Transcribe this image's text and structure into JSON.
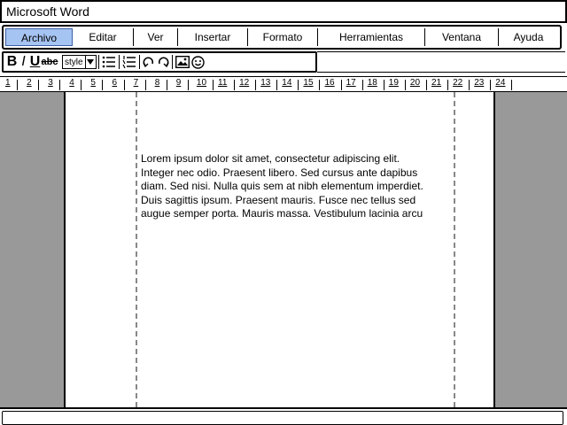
{
  "window": {
    "title": "Microsoft Word"
  },
  "menu": {
    "items": [
      {
        "label": "Archivo",
        "active": true
      },
      {
        "label": "Editar"
      },
      {
        "label": "Ver"
      },
      {
        "label": "Insertar"
      },
      {
        "label": "Formato"
      },
      {
        "label": "Herramientas"
      },
      {
        "label": "Ventana"
      },
      {
        "label": "Ayuda"
      }
    ],
    "active_color": "#a6c4f2"
  },
  "toolbar": {
    "bold": "B",
    "italic": "I",
    "underline": "U",
    "strike": "abc",
    "style_label": "style",
    "icons": [
      "bold-icon",
      "italic-icon",
      "underline-icon",
      "strikethrough-icon",
      "style-dropdown",
      "bulleted-list-icon",
      "numbered-list-icon",
      "undo-icon",
      "redo-icon",
      "image-icon",
      "emoji-icon"
    ]
  },
  "ruler": {
    "ticks": [
      "1",
      "2",
      "3",
      "4",
      "5",
      "6",
      "7",
      "8",
      "9",
      "10",
      "11",
      "12",
      "13",
      "14",
      "15",
      "16",
      "17",
      "18",
      "19",
      "20",
      "21",
      "22",
      "23",
      "24"
    ]
  },
  "document": {
    "lines": [
      "Lorem ipsum dolor sit amet, consectetur adipiscing elit.",
      "Integer nec odio. Praesent libero. Sed cursus ante dapibus",
      "diam. Sed nisi. Nulla quis sem at nibh elementum imperdiet.",
      "Duis sagittis ipsum. Praesent mauris. Fusce nec tellus sed",
      "augue semper porta. Mauris massa. Vestibulum lacinia arcu"
    ]
  },
  "colors": {
    "gutter": "#999999",
    "margin_guides": "#888888"
  }
}
